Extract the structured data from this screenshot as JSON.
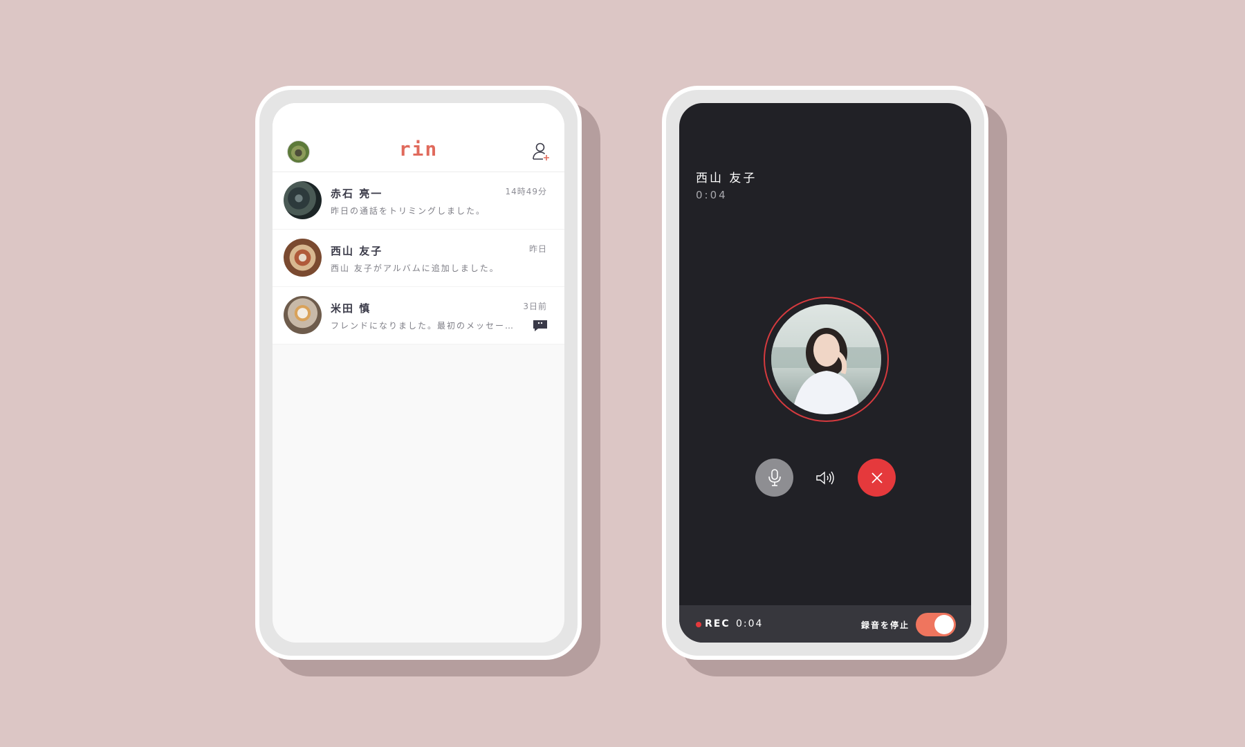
{
  "list_screen": {
    "logo": "rin",
    "chats": [
      {
        "name": "赤石 亮一",
        "time": "14時49分",
        "message": "昨日の通話をトリミングしました。",
        "unread": false
      },
      {
        "name": "西山 友子",
        "time": "昨日",
        "message": "西山 友子がアルバムに追加しました。",
        "unread": false
      },
      {
        "name": "米田 慎",
        "time": "3日前",
        "message": "フレンドになりました。最初のメッセー…",
        "unread": true
      }
    ],
    "icons": {
      "header_left": "user-avatar",
      "header_right": "add-friend-icon",
      "unread": "chat-bubble-icon"
    }
  },
  "call_screen": {
    "caller_name": "西山 友子",
    "duration": "0:04",
    "recording": {
      "label": "REC",
      "time": "0:04",
      "stop_label": "録音を停止",
      "enabled": true
    },
    "icons": {
      "mute": "microphone-icon",
      "speaker": "speaker-icon",
      "end": "close-icon"
    }
  },
  "colors": {
    "background": "#dcc6c5",
    "brand": "#e06a5c",
    "call_bg": "#212126",
    "end_call": "#e5393c",
    "toggle_on": "#ef755e"
  }
}
